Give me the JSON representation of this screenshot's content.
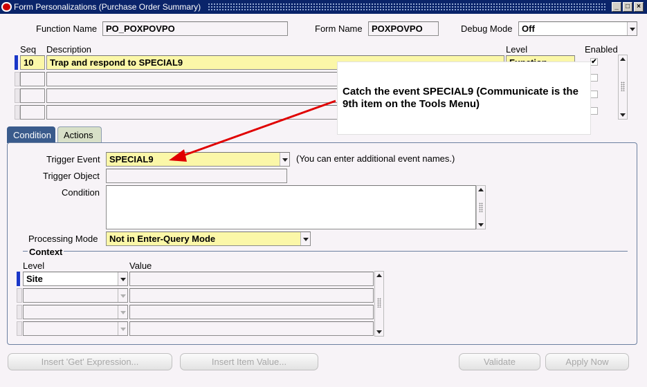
{
  "window": {
    "title": "Form Personalizations (Purchase Order Summary)",
    "minimize_glyph": "_",
    "maximize_glyph": "□",
    "close_glyph": "×"
  },
  "header": {
    "function_name_label": "Function Name",
    "function_name_value": "PO_POXPOVPO",
    "form_name_label": "Form Name",
    "form_name_value": "POXPOVPO",
    "debug_mode_label": "Debug Mode",
    "debug_mode_value": "Off"
  },
  "rules_grid": {
    "columns": {
      "seq": "Seq",
      "description": "Description",
      "level": "Level",
      "enabled": "Enabled"
    },
    "rows": [
      {
        "seq": "10",
        "description": "Trap and respond to SPECIAL9",
        "level": "Function",
        "enabled": true
      },
      {
        "seq": "",
        "description": "",
        "level": "",
        "enabled": false
      },
      {
        "seq": "",
        "description": "",
        "level": "",
        "enabled": false
      },
      {
        "seq": "",
        "description": "",
        "level": "",
        "enabled": false
      }
    ],
    "checkmark": "✔"
  },
  "callout": {
    "text": "Catch the event SPECIAL9 (Communicate is the 9th item on the Tools Menu)",
    "arrow_color": "#e00000"
  },
  "tabs": [
    {
      "label": "Condition",
      "active": true
    },
    {
      "label": "Actions",
      "active": false
    }
  ],
  "condition": {
    "trigger_event_label": "Trigger Event",
    "trigger_event_value": "SPECIAL9",
    "trigger_event_hint": "(You can enter additional event names.)",
    "trigger_object_label": "Trigger Object",
    "trigger_object_value": "",
    "condition_label": "Condition",
    "condition_value": "",
    "processing_mode_label": "Processing Mode",
    "processing_mode_value": "Not in Enter-Query Mode"
  },
  "context": {
    "title": "Context",
    "columns": {
      "level": "Level",
      "value": "Value"
    },
    "rows": [
      {
        "level": "Site",
        "value": ""
      },
      {
        "level": "",
        "value": ""
      },
      {
        "level": "",
        "value": ""
      },
      {
        "level": "",
        "value": ""
      }
    ]
  },
  "buttons": {
    "insert_get_expression": "Insert 'Get' Expression...",
    "insert_item_value": "Insert Item Value...",
    "validate": "Validate",
    "apply_now": "Apply Now"
  },
  "colors": {
    "titlebar": "#0a246a",
    "active_tab": "#3a5b8c",
    "field_yellow": "#fbf7a8",
    "row_indicator": "#1a37c8"
  }
}
